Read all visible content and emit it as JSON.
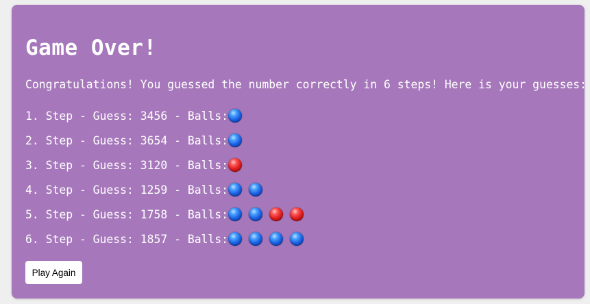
{
  "title": "Game Over!",
  "message": "Congratulations! You guessed the number correctly in 6 steps! Here is your guesses:",
  "guesses": [
    {
      "label": "1. Step - Guess: 3456 - Balls:",
      "balls": [
        "blue"
      ]
    },
    {
      "label": "2. Step - Guess: 3654 - Balls:",
      "balls": [
        "blue"
      ]
    },
    {
      "label": "3. Step - Guess: 3120 - Balls:",
      "balls": [
        "red"
      ]
    },
    {
      "label": "4. Step - Guess: 1259 - Balls:",
      "balls": [
        "blue",
        "blue"
      ]
    },
    {
      "label": "5. Step - Guess: 1758 - Balls:",
      "balls": [
        "blue",
        "blue",
        "red",
        "red"
      ]
    },
    {
      "label": "6. Step - Guess: 1857 - Balls:",
      "balls": [
        "blue",
        "blue",
        "blue",
        "blue"
      ]
    }
  ],
  "play_again_label": "Play Again",
  "colors": {
    "panel": "#a678bb",
    "page": "#efefef",
    "text": "#ffffff",
    "blue_ball": "#1a5ee0",
    "red_ball": "#dd1b1b"
  }
}
